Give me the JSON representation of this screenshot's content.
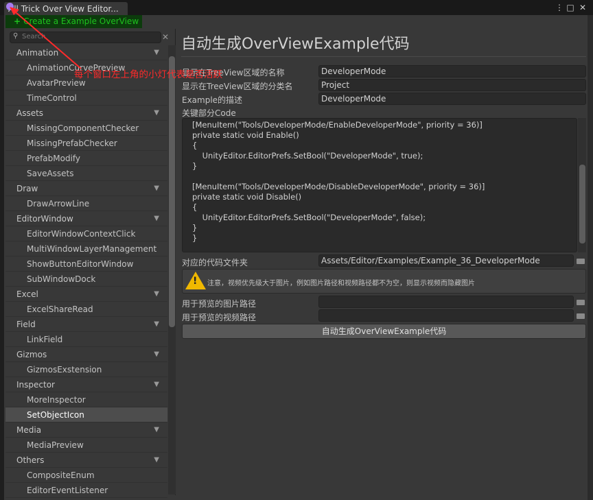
{
  "window": {
    "tab_title": "All Trick Over View Editor...",
    "menu_icon": "⋮",
    "maximize_icon": "□",
    "close_icon": "✕"
  },
  "toolbar": {
    "create_label": "Create a Example OverView",
    "create_icon": "+"
  },
  "search": {
    "placeholder": "Search",
    "clear_icon": "✕"
  },
  "list": [
    {
      "type": "h",
      "label": "Animation"
    },
    {
      "type": "i",
      "label": "AnimationCurvePreview"
    },
    {
      "type": "i",
      "label": "AvatarPreview"
    },
    {
      "type": "i",
      "label": "TimeControl"
    },
    {
      "type": "h",
      "label": "Assets"
    },
    {
      "type": "i",
      "label": "MissingComponentChecker"
    },
    {
      "type": "i",
      "label": "MissingPrefabChecker"
    },
    {
      "type": "i",
      "label": "PrefabModify"
    },
    {
      "type": "i",
      "label": "SaveAssets"
    },
    {
      "type": "h",
      "label": "Draw"
    },
    {
      "type": "i",
      "label": "DrawArrowLine"
    },
    {
      "type": "h",
      "label": "EditorWindow"
    },
    {
      "type": "i",
      "label": "EditorWindowContextClick"
    },
    {
      "type": "i",
      "label": "MultiWindowLayerManagement"
    },
    {
      "type": "i",
      "label": "ShowButtonEditorWindow"
    },
    {
      "type": "i",
      "label": "SubWindowDock"
    },
    {
      "type": "h",
      "label": "Excel"
    },
    {
      "type": "i",
      "label": "ExcelShareRead"
    },
    {
      "type": "h",
      "label": "Field"
    },
    {
      "type": "i",
      "label": "LinkField"
    },
    {
      "type": "h",
      "label": "Gizmos"
    },
    {
      "type": "i",
      "label": "GizmosExstension"
    },
    {
      "type": "h",
      "label": "Inspector"
    },
    {
      "type": "i",
      "label": "MoreInspector"
    },
    {
      "type": "i",
      "label": "SetObjectIcon",
      "selected": true
    },
    {
      "type": "h",
      "label": "Media"
    },
    {
      "type": "i",
      "label": "MediaPreview"
    },
    {
      "type": "h",
      "label": "Others"
    },
    {
      "type": "i",
      "label": "CompositeEnum"
    },
    {
      "type": "i",
      "label": "EditorEventListener"
    }
  ],
  "main": {
    "title": "自动生成OverViewExample代码",
    "fields": [
      {
        "label": "显示在TreeView区域的名称",
        "value": "DeveloperMode"
      },
      {
        "label": "显示在TreeView区域的分类名",
        "value": "Project"
      },
      {
        "label": "Example的描述",
        "value": "DeveloperMode"
      }
    ],
    "code_label": "关键部分Code",
    "code": "[MenuItem(\"Tools/DeveloperMode/EnableDeveloperMode\", priority = 36)]\nprivate static void Enable()\n{\n    UnityEditor.EditorPrefs.SetBool(\"DeveloperMode\", true);\n}\n\n[MenuItem(\"Tools/DeveloperMode/DisableDeveloperMode\", priority = 36)]\nprivate static void Disable()\n{\n    UnityEditor.EditorPrefs.SetBool(\"DeveloperMode\", false);\n}\n}",
    "folder_label": "对应的代码文件夹",
    "folder_value": "Assets/Editor/Examples/Example_36_DeveloperMode",
    "warning": "注意，视频优先级大于图片，例如图片路径和视频路径都不为空，则显示视频而隐藏图片",
    "image_path_label": "用于预览的图片路径",
    "image_path_value": "",
    "video_path_label": "用于预览的视频路径",
    "video_path_value": "",
    "generate_label": "自动生成OverViewExample代码"
  },
  "annotation": "每个窗口左上角的小灯代表是否活跃"
}
